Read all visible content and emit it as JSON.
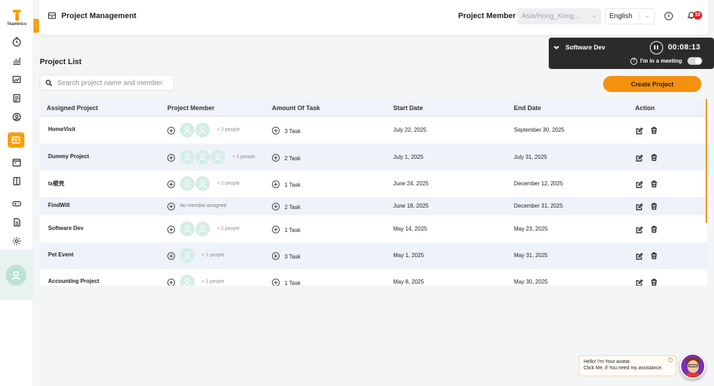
{
  "app": {
    "logo_text": "Teamtrics"
  },
  "header": {
    "title": "Project Management",
    "member_label": "Project Member",
    "timezone": "Asia/Hong_Kong...",
    "language": "English",
    "notification_count": "10"
  },
  "timer": {
    "project": "Software Dev",
    "time": "00:08:13",
    "meeting_label": "I'm in a meeting"
  },
  "page": {
    "heading": "Project List",
    "search_placeholder": "Search project name and member",
    "create_button": "Create Project"
  },
  "table": {
    "columns": [
      "Assigned Project",
      "Project Member",
      "Amount Of Task",
      "Start Date",
      "End Date",
      "Action"
    ],
    "rows": [
      {
        "name": "HomeVisit",
        "avatars": 2,
        "members": "+ 2 people",
        "tasks": "3 Task",
        "start": "July 22, 2025",
        "end": "September 30, 2025"
      },
      {
        "name": "Dummy Project",
        "avatars": 3,
        "members": "+ 3 people",
        "tasks": "2 Task",
        "start": "July 1, 2025",
        "end": "July 31, 2025"
      },
      {
        "name": "tx壁壳",
        "avatars": 2,
        "members": "+ 2 people",
        "tasks": "1 Task",
        "start": "June 24, 2025",
        "end": "December 12, 2025"
      },
      {
        "name": "FindWill",
        "avatars": 0,
        "members": "No member assigned",
        "tasks": "2 Task",
        "start": "June 18, 2025",
        "end": "December 31, 2025"
      },
      {
        "name": "Software Dev",
        "avatars": 2,
        "members": "+ 2 people",
        "tasks": "1 Task",
        "start": "May 14, 2025",
        "end": "May 23, 2025"
      },
      {
        "name": "Pet Event",
        "avatars": 1,
        "members": "+ 1 people",
        "tasks": "3 Task",
        "start": "May 1, 2025",
        "end": "May 31, 2025"
      },
      {
        "name": "Accounting Project",
        "avatars": 1,
        "members": "+ 1 people",
        "tasks": "1 Task",
        "start": "May 8, 2025",
        "end": "May 30, 2025"
      }
    ]
  },
  "assistant": {
    "line1": "Hello! I'm Your avatar.",
    "line2": "Click Me, if You need my assistance."
  },
  "colors": {
    "accent": "#f5910f",
    "row_alt": "#eef3fa",
    "badge": "#e5242b"
  }
}
